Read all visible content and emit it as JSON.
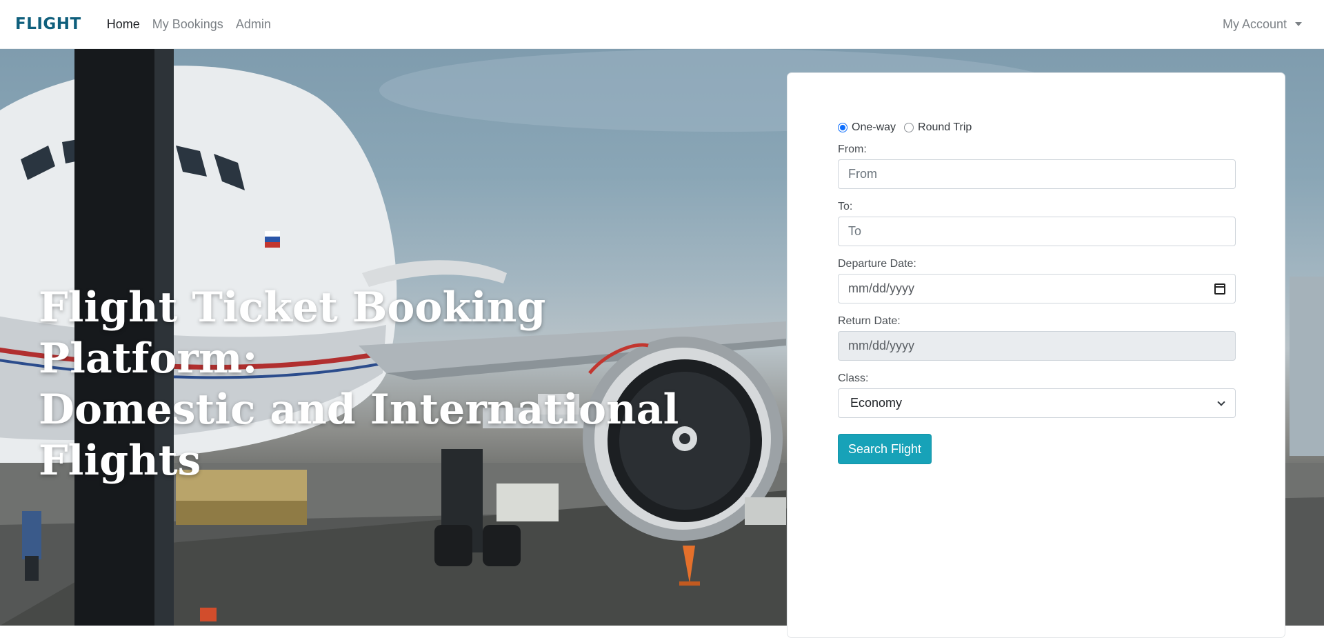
{
  "navbar": {
    "brand": "FLIGHT",
    "links": [
      {
        "label": "Home",
        "active": true
      },
      {
        "label": "My Bookings",
        "active": false
      },
      {
        "label": "Admin",
        "active": false
      }
    ],
    "account_label": "My Account"
  },
  "hero": {
    "title_lines": [
      "Flight Ticket Booking Platform:",
      "Domestic and International",
      "Flights"
    ]
  },
  "search_form": {
    "trip_types": [
      {
        "label": "One-way",
        "checked": true
      },
      {
        "label": "Round Trip",
        "checked": false
      }
    ],
    "from": {
      "label": "From:",
      "placeholder": "From",
      "value": ""
    },
    "to": {
      "label": "To:",
      "placeholder": "To",
      "value": ""
    },
    "departure_date": {
      "label": "Departure Date:",
      "placeholder": "mm/dd/yyyy"
    },
    "return_date": {
      "label": "Return Date:",
      "placeholder": "mm/dd/yyyy",
      "disabled": true
    },
    "class": {
      "label": "Class:",
      "selected": "Economy"
    },
    "submit_label": "Search Flight"
  },
  "colors": {
    "brand": "#0f5f7c",
    "button": "#17a2b8",
    "radio_checked": "#0d6efd"
  }
}
